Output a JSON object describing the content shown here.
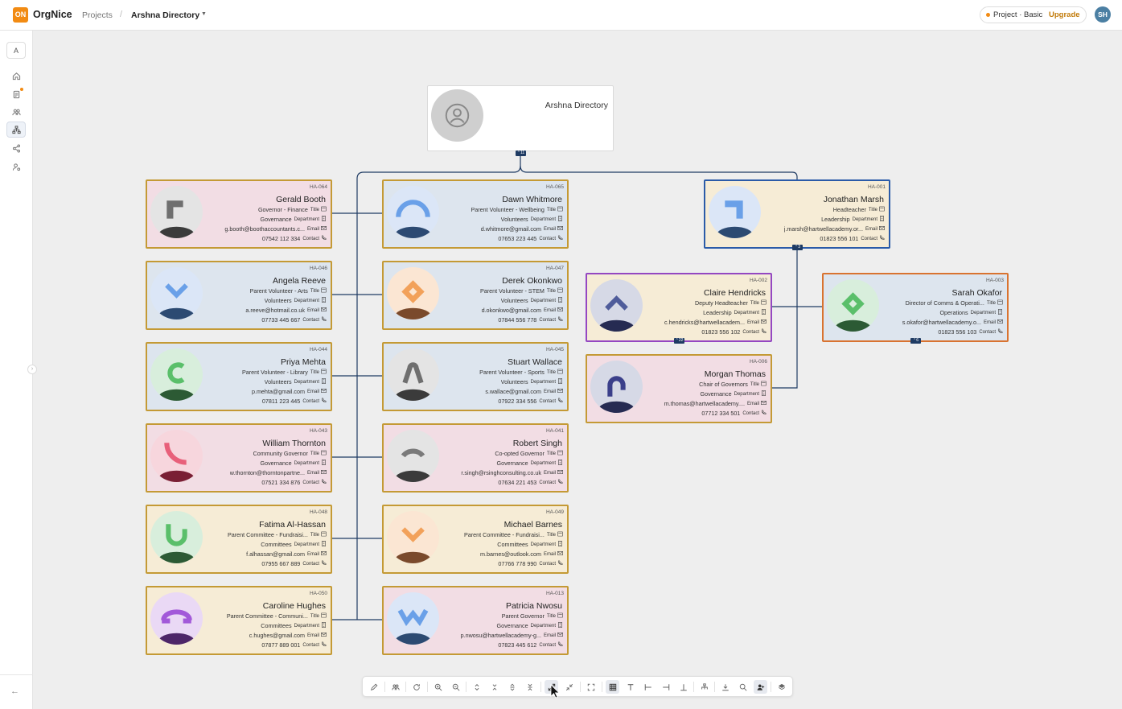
{
  "app": {
    "logo_text": "ON",
    "name": "OrgNice"
  },
  "breadcrumb": {
    "projects": "Projects",
    "separator": "/",
    "current": "Arshna Directory"
  },
  "plan": {
    "text": "Project · Basic",
    "upgrade": "Upgrade"
  },
  "user": {
    "initials": "SH"
  },
  "sidebar": {
    "top_button": "A",
    "items": [
      "home-icon",
      "document-icon",
      "people-icon",
      "org-chart-icon",
      "share-icon",
      "user-settings-icon"
    ],
    "active": "org-chart-icon"
  },
  "labels": {
    "title": "Title",
    "department": "Department",
    "email": "Email",
    "contact": "Contact"
  },
  "root": {
    "title": "Arshna Directory",
    "badge": "11"
  },
  "colors": {
    "pink_bg": "#f2dde4",
    "blue_bg": "#dde5ee",
    "cream_bg": "#f6ecd6",
    "gold_border": "#c49a35",
    "blue_border": "#2b5ba8",
    "purple_border": "#9447c2",
    "orange_border": "#d97330",
    "connector": "#1f3b63"
  },
  "cards": [
    {
      "id": "HA-064",
      "name": "Gerald Booth",
      "title": "Governor - Finance",
      "department": "Governance",
      "email": "g.booth@boothaccountants.c...",
      "contact": "07542 112 334"
    },
    {
      "id": "HA-065",
      "name": "Dawn Whitmore",
      "title": "Parent Volunteer - Wellbeing",
      "department": "Volunteers",
      "email": "d.whitmore@gmail.com",
      "contact": "07653 223 445"
    },
    {
      "id": "HA-001",
      "name": "Jonathan Marsh",
      "title": "Headteacher",
      "department": "Leadership",
      "email": "j.marsh@hartwellacademy.or...",
      "contact": "01823 556 101",
      "badge": "3"
    },
    {
      "id": "HA-046",
      "name": "Angela Reeve",
      "title": "Parent Volunteer - Arts",
      "department": "Volunteers",
      "email": "a.reeve@hotmail.co.uk",
      "contact": "07733 445 667"
    },
    {
      "id": "HA-047",
      "name": "Derek Okonkwo",
      "title": "Parent Volunteer - STEM",
      "department": "Volunteers",
      "email": "d.okonkwo@gmail.com",
      "contact": "07844 556 778"
    },
    {
      "id": "HA-002",
      "name": "Claire Hendricks",
      "title": "Deputy Headteacher",
      "department": "Leadership",
      "email": "c.hendricks@hartwellacadem...",
      "contact": "01823 556 102",
      "badge": "22"
    },
    {
      "id": "HA-003",
      "name": "Sarah Okafor",
      "title": "Director of Comms & Operati...",
      "department": "Operations",
      "email": "s.okafor@hartwellacademy.o...",
      "contact": "01823 556 103",
      "badge": "6"
    },
    {
      "id": "HA-044",
      "name": "Priya Mehta",
      "title": "Parent Volunteer - Library",
      "department": "Volunteers",
      "email": "p.mehta@gmail.com",
      "contact": "07811 223 445"
    },
    {
      "id": "HA-045",
      "name": "Stuart Wallace",
      "title": "Parent Volunteer - Sports",
      "department": "Volunteers",
      "email": "s.wallace@gmail.com",
      "contact": "07922 334 556"
    },
    {
      "id": "HA-006",
      "name": "Morgan Thomas",
      "title": "Chair of Governors",
      "department": "Governance",
      "email": "m.thomas@hartwellacademy....",
      "contact": "07712 334 501"
    },
    {
      "id": "HA-043",
      "name": "William Thornton",
      "title": "Community Governor",
      "department": "Governance",
      "email": "w.thornton@thorntonpartne...",
      "contact": "07521 334 876"
    },
    {
      "id": "HA-041",
      "name": "Robert Singh",
      "title": "Co-opted Governor",
      "department": "Governance",
      "email": "r.singh@rsinghconsulting.co.uk",
      "contact": "07634 221 453"
    },
    {
      "id": "HA-048",
      "name": "Fatima Al-Hassan",
      "title": "Parent Committee - Fundraisi...",
      "department": "Committees",
      "email": "f.alhassan@gmail.com",
      "contact": "07955 667 889"
    },
    {
      "id": "HA-049",
      "name": "Michael Barnes",
      "title": "Parent Committee - Fundraisi...",
      "department": "Committees",
      "email": "m.barnes@outlook.com",
      "contact": "07766 778 990"
    },
    {
      "id": "HA-050",
      "name": "Caroline Hughes",
      "title": "Parent Committee - Communi...",
      "department": "Committees",
      "email": "c.hughes@gmail.com",
      "contact": "07877 889 001"
    },
    {
      "id": "HA-013",
      "name": "Patricia Nwosu",
      "title": "Parent Governor",
      "department": "Governance",
      "email": "p.nwosu@hartwellacademy-g...",
      "contact": "07823 445 612"
    }
  ],
  "toolbar": {
    "buttons": [
      "pencil-icon",
      "group-icon",
      "refresh-icon",
      "zoom-in-icon",
      "zoom-out-icon",
      "expand-vertical-icon",
      "collapse-vertical-icon",
      "expand-all-icon",
      "collapse-all-icon",
      "fit-expand-icon",
      "fit-collapse-icon",
      "fullscreen-icon",
      "grid-icon",
      "text-icon",
      "align-left-icon",
      "align-right-icon",
      "align-bottom-icon",
      "hierarchy-icon",
      "download-icon",
      "search-icon",
      "person-add-icon",
      "layers-icon"
    ]
  }
}
